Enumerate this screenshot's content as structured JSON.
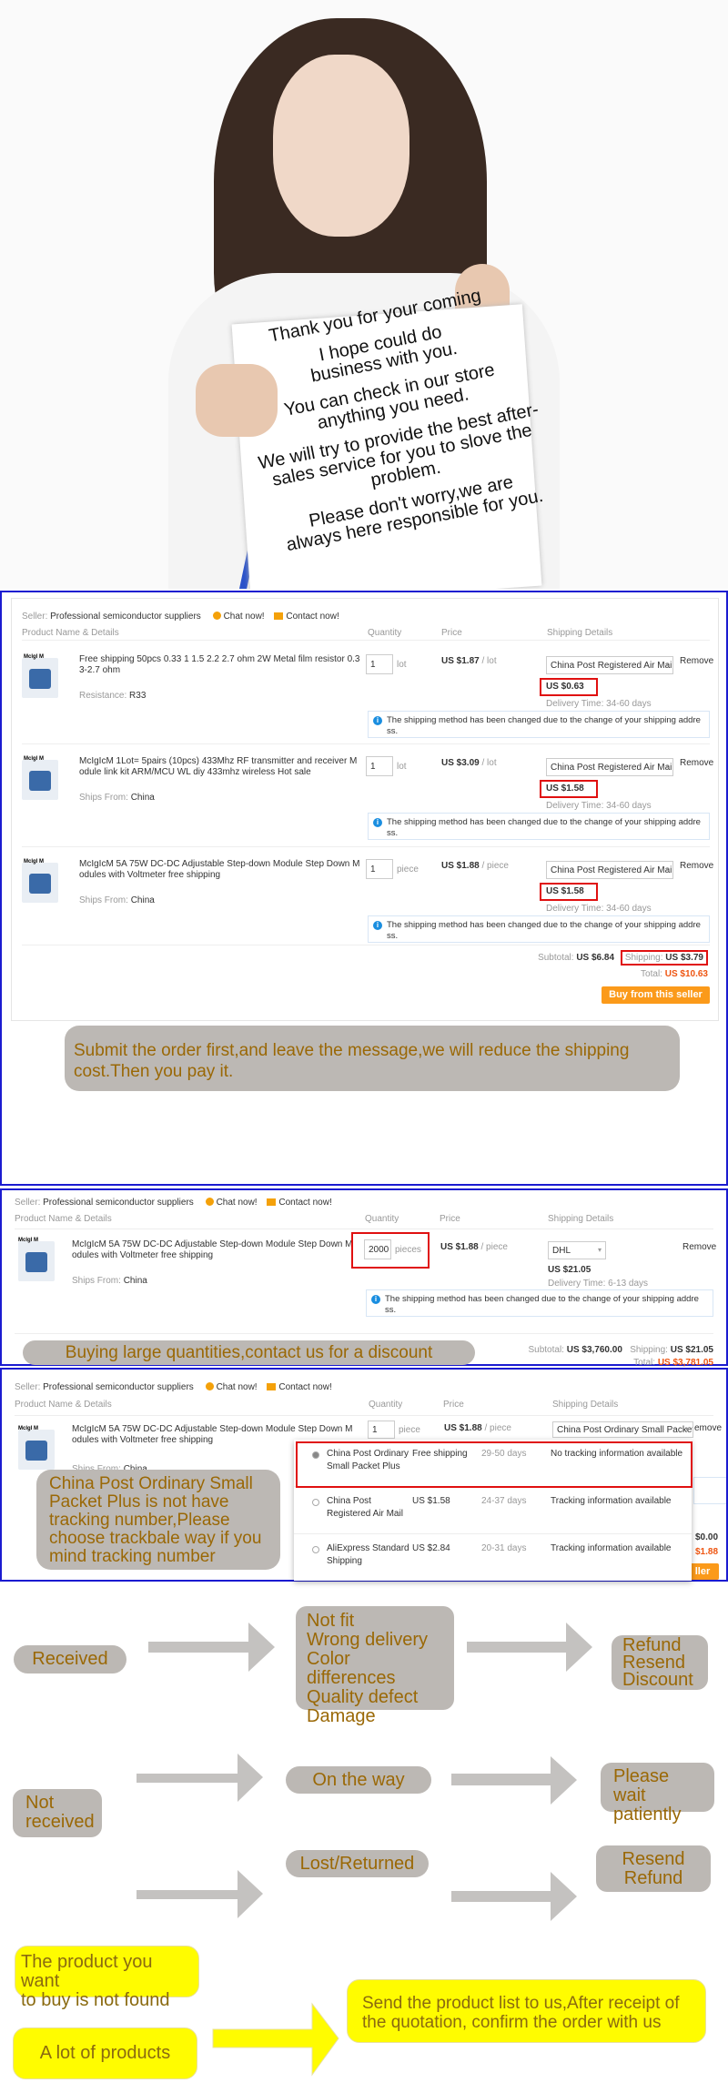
{
  "sign": {
    "lines": [
      "Thank you for your coming",
      "I hope could do business with you.",
      "You can check in our store anything you need.",
      "We will try to provide the best after-sales service for you to slove the problem.",
      "Please don't worry,we are always here responsible for you."
    ]
  },
  "cart1": {
    "seller_label": "Seller:",
    "seller": "Professional semiconductor suppliers",
    "chat": "Chat now!",
    "contact": "Contact now!",
    "headers": [
      "Product Name & Details",
      "Quantity",
      "Price",
      "Shipping Details"
    ],
    "items": [
      {
        "logo": "Mclgl M",
        "title1": "Free shipping 50pcs 0.33 1 1.5 2.2 2.7 ohm 2W Metal film resistor 0.3",
        "title2": "3-2.7 ohm",
        "attr_label": "Resistance:",
        "attr": "R33",
        "qty": "1",
        "unit": "lot",
        "price": "US $1.87",
        "per": "/ lot",
        "shipping": "China Post Registered Air Mail",
        "ship_cost": "US $0.63",
        "delivery_label": "Delivery Time:",
        "delivery": "34-60 days",
        "remove": "Remove",
        "notice1": "The shipping method has been changed due to the change of your shipping addre",
        "notice2": "ss."
      },
      {
        "logo": "Mclgl M",
        "title1": "McIgIcM 1Lot= 5pairs (10pcs) 433Mhz RF transmitter and receiver M",
        "title2": "odule link kit ARM/MCU WL diy 433mhz wireless Hot sale",
        "attr_label": "Ships From:",
        "attr": "China",
        "qty": "1",
        "unit": "lot",
        "price": "US $3.09",
        "per": "/ lot",
        "shipping": "China Post Registered Air Mail",
        "ship_cost": "US $1.58",
        "delivery_label": "Delivery Time:",
        "delivery": "34-60 days",
        "remove": "Remove",
        "notice1": "The shipping method has been changed due to the change of your shipping addre",
        "notice2": "ss."
      },
      {
        "logo": "Mclgl M",
        "title1": "McIgIcM 5A 75W DC-DC Adjustable Step-down Module Step Down M",
        "title2": "odules with Voltmeter free shipping",
        "attr_label": "Ships From:",
        "attr": "China",
        "qty": "1",
        "unit": "piece",
        "price": "US $1.88",
        "per": "/ piece",
        "shipping": "China Post Registered Air Mail",
        "ship_cost": "US $1.58",
        "delivery_label": "Delivery Time:",
        "delivery": "34-60 days",
        "remove": "Remove",
        "notice1": "The shipping method has been changed due to the change of your shipping addre",
        "notice2": "ss."
      }
    ],
    "subtotal_label": "Subtotal:",
    "subtotal": "US $6.84",
    "shipping_label": "Shipping:",
    "shipping": "US $3.79",
    "total_label": "Total:",
    "total": "US $10.63",
    "buy": "Buy from this seller",
    "message": "Submit the order first,and leave the message,we will reduce the shipping cost.Then you pay it."
  },
  "cart2": {
    "seller_label": "Seller:",
    "seller": "Professional semiconductor suppliers",
    "chat": "Chat now!",
    "contact": "Contact now!",
    "headers": [
      "Product Name & Details",
      "Quantity",
      "Price",
      "Shipping Details"
    ],
    "item": {
      "logo": "Mclgl M",
      "title1": "McIgIcM 5A 75W DC-DC Adjustable Step-down Module Step Down M",
      "title2": "odules with Voltmeter free shipping",
      "attr_label": "Ships From:",
      "attr": "China",
      "qty": "2000",
      "unit": "pieces",
      "price": "US $1.88",
      "per": "/ piece",
      "shipping": "DHL",
      "ship_cost": "US $21.05",
      "delivery_label": "Delivery Time:",
      "delivery": "6-13 days",
      "remove": "Remove",
      "notice1": "The shipping method has been changed due to the change of your shipping addre",
      "notice2": "ss."
    },
    "subtotal_label": "Subtotal:",
    "subtotal": "US $3,760.00",
    "shipping_label": "Shipping:",
    "shipping": "US $21.05",
    "total_label": "Total:",
    "total": "US $3,781.05",
    "message": "Buying large quantities,contact us for a discount"
  },
  "cart3": {
    "seller_label": "Seller:",
    "seller": "Professional semiconductor suppliers",
    "chat": "Chat now!",
    "contact": "Contact now!",
    "headers": [
      "Product Name & Details",
      "Quantity",
      "Price",
      "Shipping Details"
    ],
    "item": {
      "logo": "Mclgl M",
      "title1": "McIgIcM 5A 75W DC-DC Adjustable Step-down Module Step Down M",
      "title2": "odules with Voltmeter free shipping",
      "attr_label": "Ships From:",
      "attr": "China",
      "qty": "1",
      "unit": "piece",
      "price": "US $1.88",
      "per": "/ piece",
      "shipping": "China Post Ordinary Small Packet",
      "remove": "emove"
    },
    "options": [
      {
        "name1": "China Post Ordinary",
        "name2": "Small Packet Plus",
        "cost": "Free shipping",
        "days": "29-50 days",
        "tracking": "No tracking information available",
        "selected": true
      },
      {
        "name1": "China Post",
        "name2": "Registered Air Mail",
        "cost": "US $1.58",
        "days": "24-37 days",
        "tracking": "Tracking information available",
        "selected": false
      },
      {
        "name1": "AliExpress Standard",
        "name2": "Shipping",
        "cost": "US $2.84",
        "days": "20-31 days",
        "tracking": "Tracking information available",
        "selected": false
      }
    ],
    "shipping_partial": "$0.00",
    "total_partial": "$1.88",
    "buy_partial": "ller",
    "message": "China Post Ordinary Small Packet Plus is not have tracking number,Please choose trackbale way if you mind tracking number"
  },
  "flow": {
    "received": "Received",
    "reasons": [
      "Not fit",
      "Wrong delivery",
      "Color differences",
      "Quality defect",
      "Damage"
    ],
    "solutions": [
      "Refund",
      "Resend",
      "Discount"
    ],
    "not_received": [
      "Not",
      "received"
    ],
    "on_the_way": "On the way",
    "please_wait": [
      "Please wait",
      "patiently"
    ],
    "lost": "Lost/Returned",
    "lost_solutions": [
      "Resend",
      "Refund"
    ],
    "not_found": [
      "The product you want",
      "to buy is not found"
    ],
    "lot": "A lot of products",
    "send_list": [
      "Send the product list to us,After receipt of",
      "the quotation, confirm the order with us"
    ]
  },
  "colors": {
    "frame": "#1b1bd0",
    "highlight": "#e01010",
    "button": "#fb9a1a",
    "callout_gray": "#bcb8b4",
    "callout_text": "#9a6806",
    "yellow": "#fffc00",
    "price_total": "#ee5511"
  }
}
